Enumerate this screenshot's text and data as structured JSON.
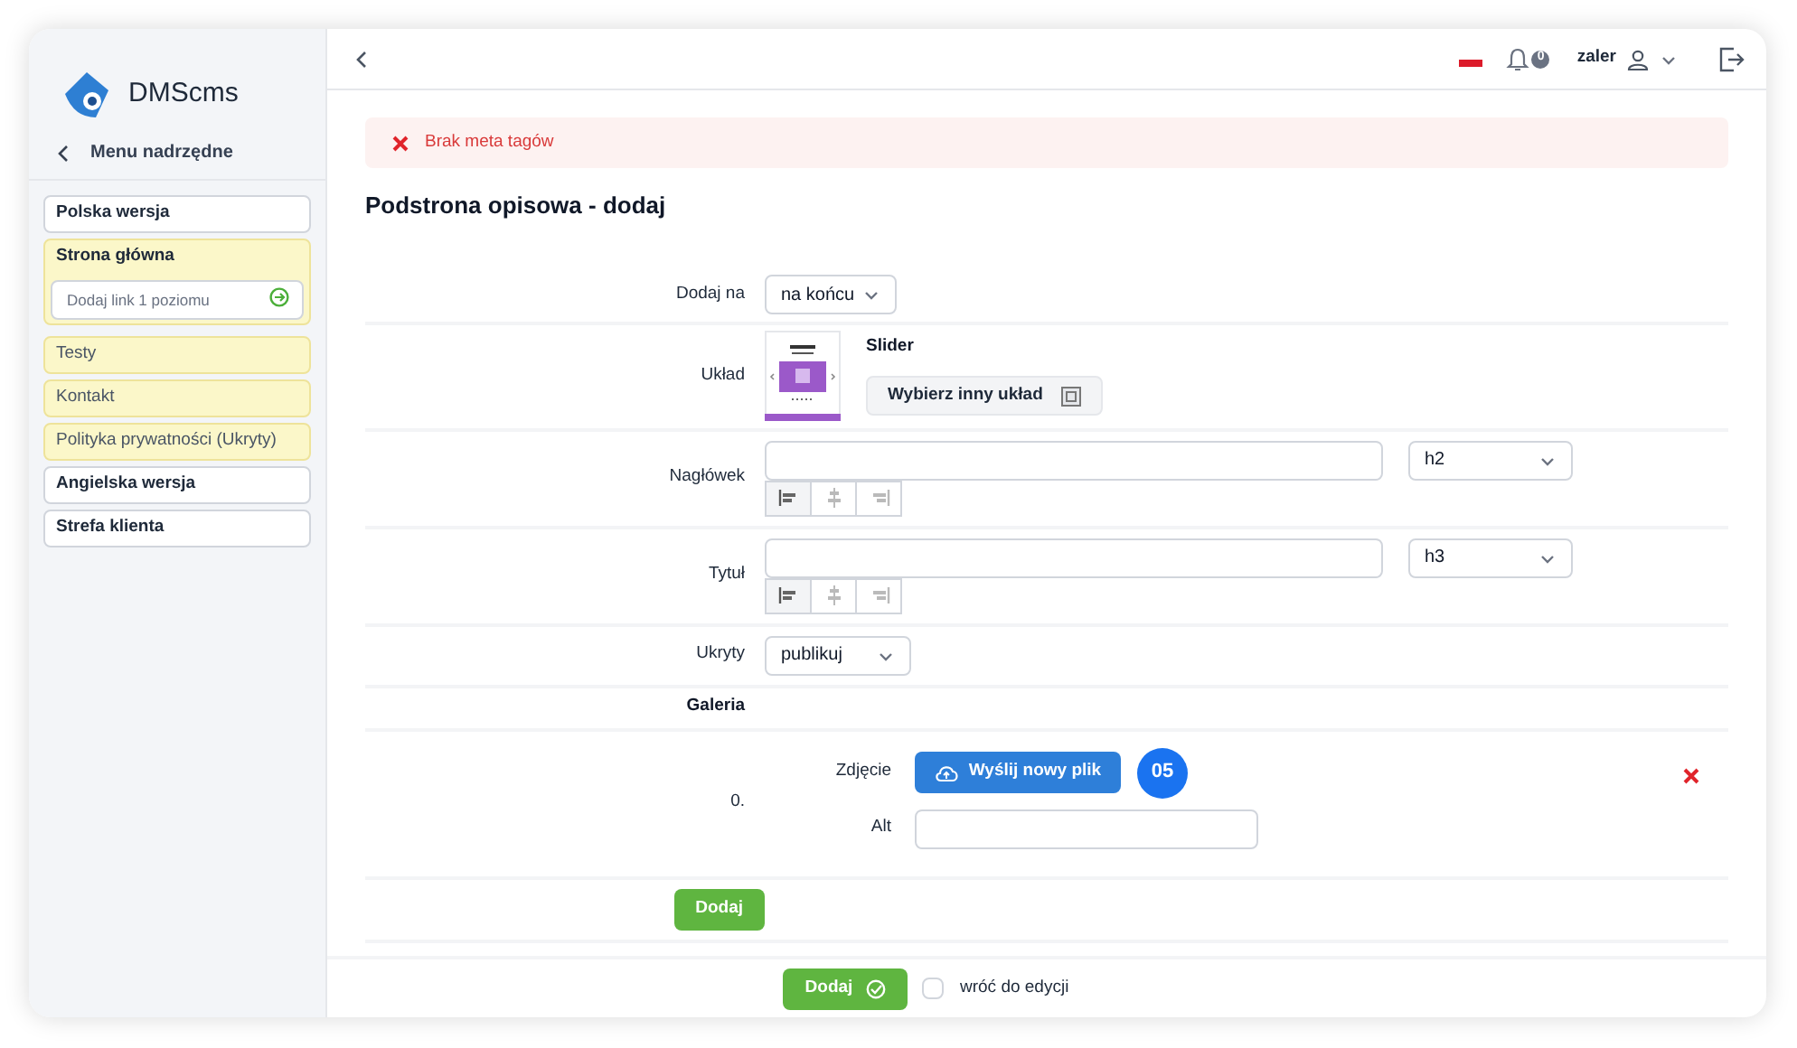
{
  "brand": {
    "name": "DMScms"
  },
  "sidebar": {
    "back_label": "Menu nadrzędne",
    "items": [
      {
        "label": "Polska wersja",
        "highlighted": false,
        "bold": true
      },
      {
        "label": "Strona główna",
        "highlighted": true,
        "bold": true,
        "add_field": {
          "placeholder": "Dodaj link 1 poziomu"
        }
      },
      {
        "label": "Testy",
        "highlighted": true,
        "bold": false
      },
      {
        "label": "Kontakt",
        "highlighted": true,
        "bold": false
      },
      {
        "label": "Polityka prywatności (Ukryty)",
        "highlighted": true,
        "bold": false
      },
      {
        "label": "Angielska wersja",
        "highlighted": false,
        "bold": true
      },
      {
        "label": "Strefa klienta",
        "highlighted": false,
        "bold": true
      }
    ]
  },
  "topbar": {
    "notifications": "0",
    "user": "zaler"
  },
  "alert": {
    "text": "Brak meta tagów"
  },
  "page_title": "Podstrona opisowa - dodaj",
  "form": {
    "position": {
      "label": "Dodaj na",
      "value": "na końcu"
    },
    "layout": {
      "label": "Układ",
      "name": "Slider",
      "button": "Wybierz inny układ"
    },
    "headings": [
      {
        "label": "Nagłówek",
        "level": "h2",
        "align": [
          {
            "selected": true
          },
          {
            "selected": false
          },
          {
            "selected": false
          }
        ]
      },
      {
        "label": "Tytuł",
        "level": "h3",
        "align": [
          {
            "selected": true
          },
          {
            "selected": false
          },
          {
            "selected": false
          }
        ]
      }
    ],
    "hidden": {
      "label": "Ukryty",
      "value": "publikuj"
    },
    "gallery": {
      "label": "Galeria",
      "items": [
        {
          "index": "0.",
          "photo_label": "Zdjęcie",
          "upload_button": "Wyślij nowy plik",
          "badge": "05",
          "alt_label": "Alt"
        }
      ],
      "add_button": "Dodaj"
    }
  },
  "footer": {
    "submit": "Dodaj",
    "return_label": "wróć do edycji",
    "return_checked": false
  }
}
